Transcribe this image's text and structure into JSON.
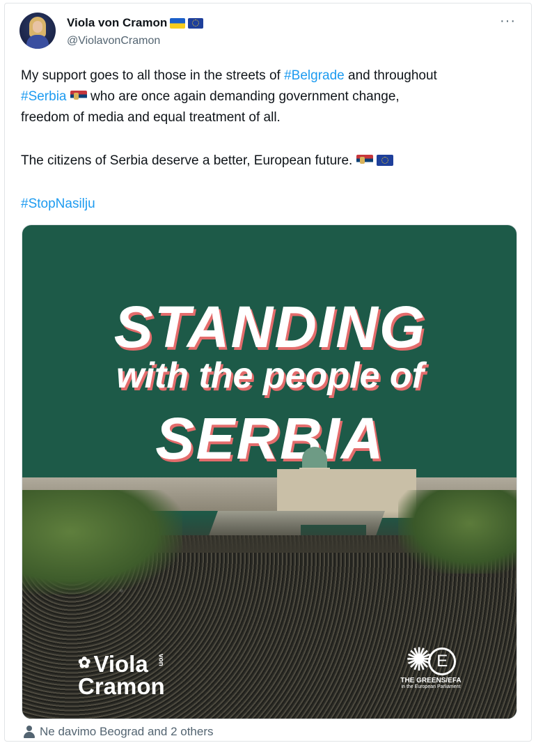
{
  "post": {
    "author": {
      "name": "Viola von Cramon",
      "handle": "@ViolavonCramon",
      "name_emoji": [
        "ukraine-flag",
        "eu-flag"
      ]
    },
    "more_label": "···",
    "body": {
      "line1_a": "My support goes to all those in the streets of ",
      "line1_tag": "#Belgrade",
      "line1_b": " and throughout",
      "line2_tag": "#Serbia",
      "line2_b": " who are once again demanding government change,",
      "line3": "freedom of media and equal treatment of all.",
      "line4": "The citizens of Serbia deserve a better, European future.",
      "line5_tag": "#StopNasilju"
    },
    "media": {
      "headline_1": "STANDING",
      "headline_2": "with the people of",
      "headline_3": "SERBIA",
      "logo_left_1": "Viola",
      "logo_left_von": "von",
      "logo_left_2": "Cramon",
      "logo_right_1": "THE GREENS/EFA",
      "logo_right_2": "in the European Parliament",
      "colors": {
        "background": "#1d5a48",
        "headline_shadow": "#e46c6c"
      }
    },
    "tagged": "Ne davimo Beograd and 2 others"
  },
  "colors": {
    "link": "#1d9bf0",
    "secondary_text": "#536471"
  }
}
